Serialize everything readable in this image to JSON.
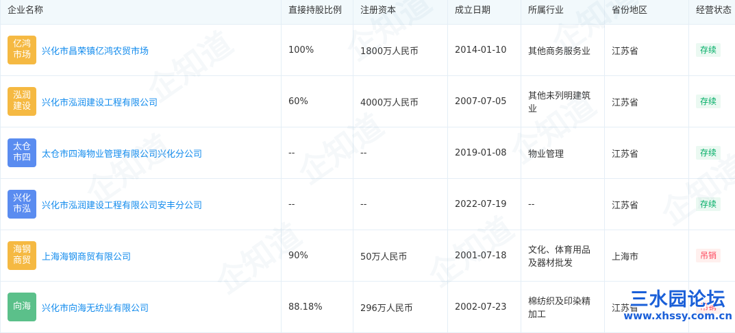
{
  "table": {
    "headers": [
      "企业名称",
      "直接持股比例",
      "注册资本",
      "成立日期",
      "所属行业",
      "省份地区",
      "经营状态"
    ],
    "rows": [
      {
        "logo_text": "亿鸿市场",
        "logo_color": "#f5b942",
        "name": "兴化市昌荣镇亿鸿农贸市场",
        "ratio": "100%",
        "capital": "1800万人民币",
        "date": "2014-01-10",
        "industry": "其他商务服务业",
        "region": "江苏省",
        "status": "存续",
        "status_type": "green"
      },
      {
        "logo_text": "泓润建设",
        "logo_color": "#f5b942",
        "name": "兴化市泓润建设工程有限公司",
        "ratio": "60%",
        "capital": "4000万人民币",
        "date": "2007-07-05",
        "industry": "其他未列明建筑业",
        "region": "江苏省",
        "status": "存续",
        "status_type": "green"
      },
      {
        "logo_text": "太仓市四",
        "logo_color": "#5a8cf0",
        "name": "太仓市四海物业管理有限公司兴化分公司",
        "ratio": "--",
        "capital": "--",
        "date": "2019-01-08",
        "industry": "物业管理",
        "region": "江苏省",
        "status": "存续",
        "status_type": "green"
      },
      {
        "logo_text": "兴化市泓",
        "logo_color": "#5a8cf0",
        "name": "兴化市泓润建设工程有限公司安丰分公司",
        "ratio": "--",
        "capital": "--",
        "date": "2022-07-19",
        "industry": "--",
        "region": "江苏省",
        "status": "存续",
        "status_type": "green"
      },
      {
        "logo_text": "海钢商贸",
        "logo_color": "#f5b942",
        "name": "上海海钢商贸有限公司",
        "ratio": "90%",
        "capital": "50万人民币",
        "date": "2001-07-18",
        "industry": "文化、体育用品及器材批发",
        "region": "上海市",
        "status": "吊销",
        "status_type": "red"
      },
      {
        "logo_text": "向海",
        "logo_color": "#5bc08a",
        "name": "兴化市向海无纺业有限公司",
        "ratio": "88.18%",
        "capital": "296万人民币",
        "date": "2002-07-23",
        "industry": "棉纺织及印染精加工",
        "region": "江苏省",
        "status": "吊销",
        "status_type": "red"
      }
    ]
  },
  "watermark": {
    "text": "企知道"
  },
  "site_logo": {
    "title": "三水园论坛",
    "url": "www.xhssy.com.cn"
  }
}
